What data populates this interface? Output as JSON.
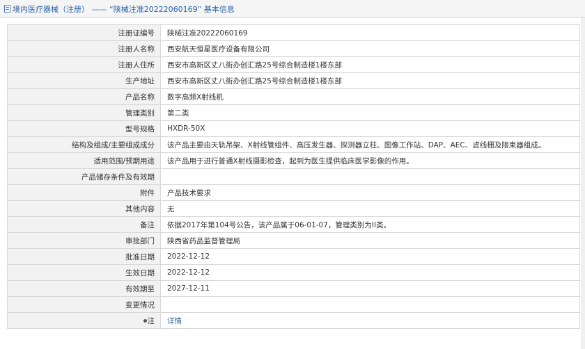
{
  "header": {
    "title": "境内医疗器械（注册） —— “陕械注准20222060169” 基本信息"
  },
  "rows": [
    {
      "label": "注册证编号",
      "value": "陕械注准20222060169"
    },
    {
      "label": "注册人名称",
      "value": "西安航天恒星医疗设备有限公司"
    },
    {
      "label": "注册人住所",
      "value": "西安市高新区丈八街办创汇路25号综合制造楼1楼东部"
    },
    {
      "label": "生产地址",
      "value": "西安市高新区丈八街办创汇路25号综合制造楼1楼东部"
    },
    {
      "label": "产品名称",
      "value": "数字高频X射线机"
    },
    {
      "label": "管理类别",
      "value": "第二类"
    },
    {
      "label": "型号规格",
      "value": "HXDR-50X"
    },
    {
      "label": "结构及组成/主要组成成分",
      "value": "该产品主要由天轨吊架、X射线管组件、高压发生器、探测器立柱、图像工作站、DAP、AEC、滤线栅及限束器组成。"
    },
    {
      "label": "适用范围/预期用途",
      "value": "该产品用于进行普通X射线摄影检查，起到为医生提供临床医学影像的作用。"
    },
    {
      "label": "产品储存条件及有效期",
      "value": ""
    },
    {
      "label": "附件",
      "value": "产品技术要求"
    },
    {
      "label": "其他内容",
      "value": "无"
    },
    {
      "label": "备注",
      "value": "依据2017年第104号公告，该产品属于06-01-07，管理类别为II类。"
    },
    {
      "label": "审批部门",
      "value": "陕西省药品监督管理局"
    },
    {
      "label": "批准日期",
      "value": "2022-12-12"
    },
    {
      "label": "生效日期",
      "value": "2022-12-12"
    },
    {
      "label": "有效期至",
      "value": "2027-12-11"
    },
    {
      "label": "变更情况",
      "value": ""
    }
  ],
  "note_row": {
    "label": "注",
    "icon": "pin-icon",
    "link": "详情"
  }
}
